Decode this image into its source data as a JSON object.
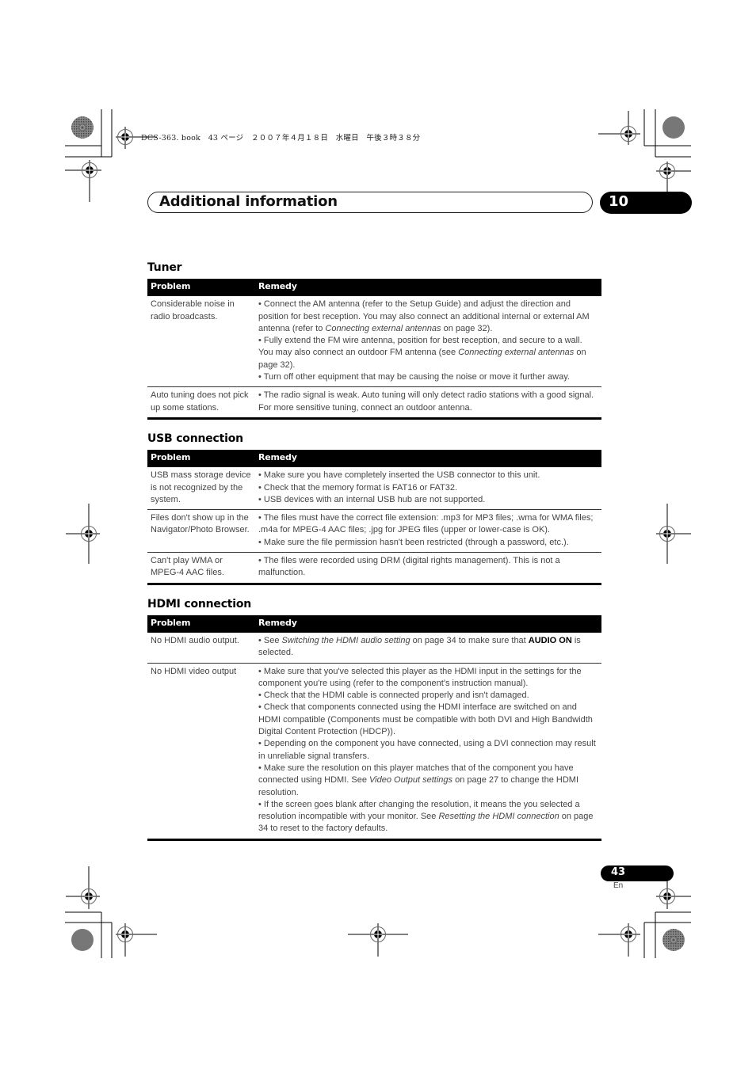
{
  "print_header": {
    "file": "DCS-363. book",
    "page": "43",
    "page_word": "ページ",
    "date": "２００７年４月１８日",
    "weekday": "水曜日",
    "time": "午後３時３８分"
  },
  "chapter": {
    "title": "Additional information",
    "number": "10"
  },
  "columns": {
    "problem": "Problem",
    "remedy": "Remedy"
  },
  "sections": [
    {
      "title": "Tuner",
      "rows": [
        {
          "problem": "Considerable noise in radio broadcasts.",
          "remedy": [
            [
              {
                "t": "• Connect the AM antenna (refer to the Setup Guide) and adjust the direction and position for best reception. You may also connect an additional internal or external AM antenna (refer to "
              },
              {
                "t": "Connecting external antennas",
                "s": "i"
              },
              {
                "t": " on page 32)."
              }
            ],
            [
              {
                "t": "• Fully extend the FM wire antenna, position for best reception, and secure to a wall. You may also connect an outdoor FM antenna (see "
              },
              {
                "t": "Connecting external antennas",
                "s": "i"
              },
              {
                "t": " on page 32)."
              }
            ],
            [
              {
                "t": "• Turn off other equipment that may be causing the noise or move it further away."
              }
            ]
          ]
        },
        {
          "problem": "Auto tuning does not pick up some stations.",
          "remedy": [
            [
              {
                "t": "• The radio signal is weak. Auto tuning will only detect radio stations with a good signal. For more sensitive tuning, connect an outdoor antenna."
              }
            ]
          ]
        }
      ]
    },
    {
      "title": "USB connection",
      "rows": [
        {
          "problem": "USB mass storage device is not recognized by the system.",
          "remedy": [
            [
              {
                "t": "• Make sure you have completely inserted the USB connector to this unit."
              }
            ],
            [
              {
                "t": "• Check that the memory format is FAT16 or FAT32."
              }
            ],
            [
              {
                "t": "• USB devices with an internal USB hub are not supported."
              }
            ]
          ]
        },
        {
          "problem": "Files don't show up in the Navigator/Photo Browser.",
          "remedy": [
            [
              {
                "t": "• The files must have the correct file extension: .mp3 for MP3 files; .wma for WMA files; .m4a for MPEG-4 AAC files; .jpg for JPEG files (upper or lower-case is OK)."
              }
            ],
            [
              {
                "t": "• Make sure the file permission hasn't been restricted (through a password, etc.)."
              }
            ]
          ]
        },
        {
          "problem": "Can't play WMA or MPEG-4 AAC files.",
          "remedy": [
            [
              {
                "t": "• The files were recorded using DRM (digital rights management). This is not a malfunction."
              }
            ]
          ]
        }
      ]
    },
    {
      "title": "HDMI connection",
      "rows": [
        {
          "problem": "No HDMI audio output.",
          "remedy": [
            [
              {
                "t": "• See "
              },
              {
                "t": "Switching the HDMI audio setting",
                "s": "i"
              },
              {
                "t": " on page 34 to make sure that "
              },
              {
                "t": "AUDIO ON",
                "s": "b"
              },
              {
                "t": " is selected."
              }
            ]
          ]
        },
        {
          "problem": "No HDMI video output",
          "remedy": [
            [
              {
                "t": "• Make sure that you've selected this player as the HDMI input in the settings for the component you're using (refer to the component's instruction manual)."
              }
            ],
            [
              {
                "t": "• Check that the HDMI cable is connected properly and isn't damaged."
              }
            ],
            [
              {
                "t": "• Check that components connected using the HDMI interface are switched on and HDMI compatible (Components must be compatible with both DVI and High Bandwidth Digital Content Protection (HDCP))."
              }
            ],
            [
              {
                "t": "• Depending on the component you have connected, using a DVI connection may result in unreliable signal transfers."
              }
            ],
            [
              {
                "t": "• Make sure the resolution on this player matches that of the component you have connected using HDMI. See "
              },
              {
                "t": "Video Output settings",
                "s": "i"
              },
              {
                "t": " on page 27 to change the HDMI resolution."
              }
            ],
            [
              {
                "t": "• If the screen goes blank after changing the resolution, it means the you selected a resolution incompatible with your monitor. See "
              },
              {
                "t": "Resetting the HDMI connection",
                "s": "i"
              },
              {
                "t": " on page 34 to reset to the factory defaults."
              }
            ]
          ]
        }
      ]
    }
  ],
  "footer": {
    "page_number": "43",
    "language": "En"
  }
}
